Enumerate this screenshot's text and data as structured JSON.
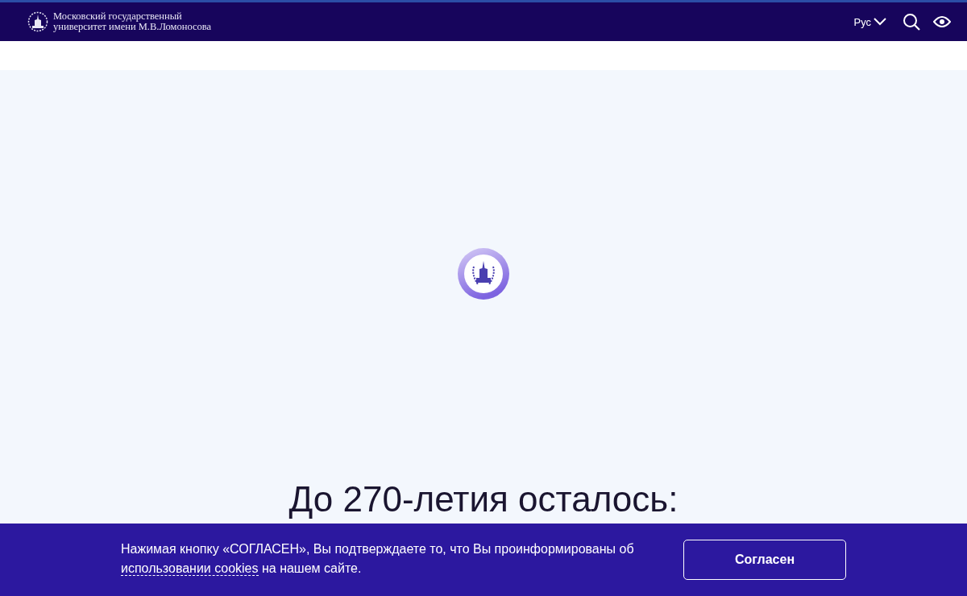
{
  "header": {
    "title_line_1": "Московский государственный",
    "title_line_2": "университет имени М.В.Ломоносова",
    "language": "Рус"
  },
  "countdown": {
    "heading": "До 270-летия осталось:"
  },
  "cookie_banner": {
    "text_before": "Нажимая кнопку «СОГЛАСЕН», Вы подтверждаете то, что Вы проинформированы об",
    "link": "использовании cookies",
    "text_after": "на нашем сайте.",
    "button": "Согласен"
  }
}
